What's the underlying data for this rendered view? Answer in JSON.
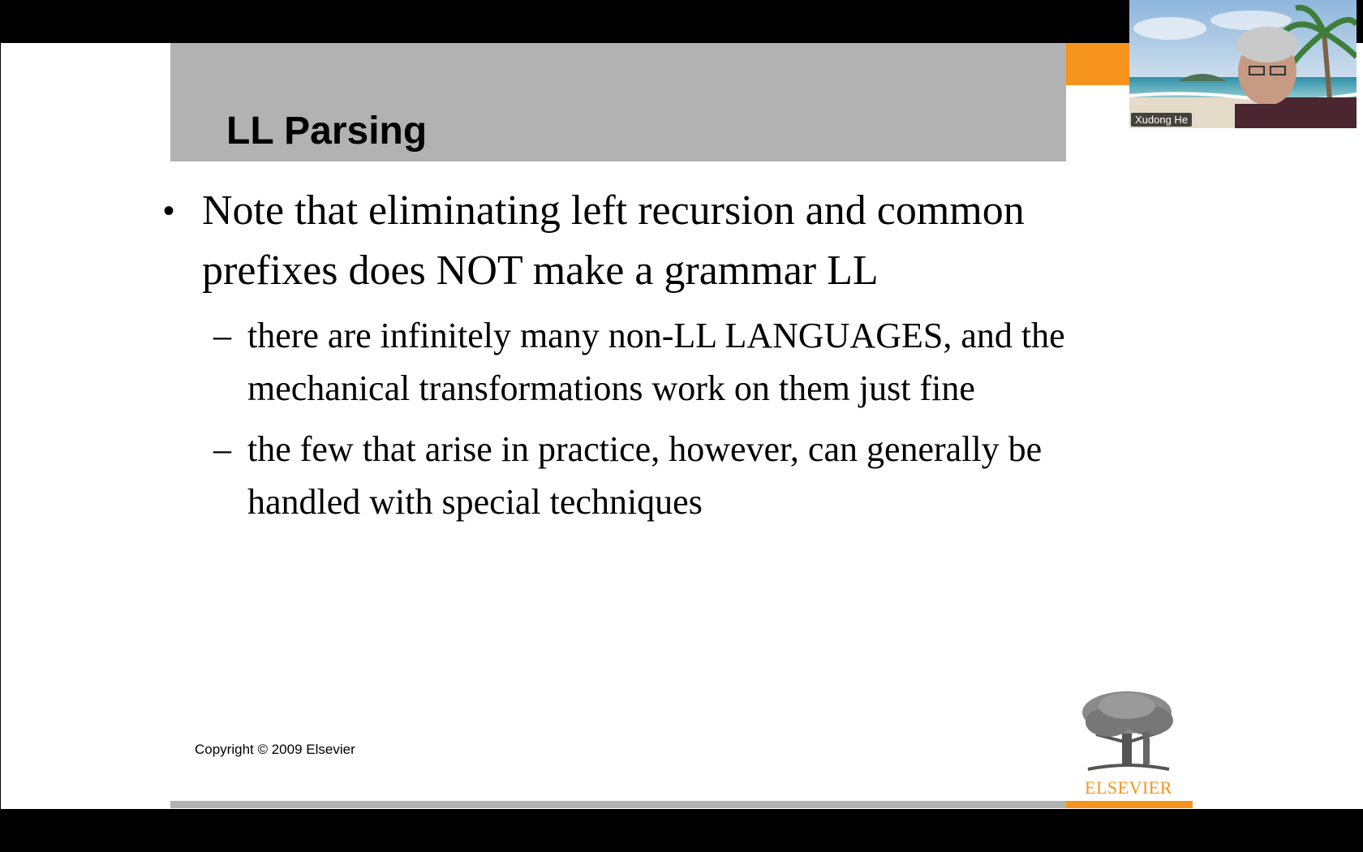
{
  "slide": {
    "title": "LL Parsing",
    "bullets": [
      {
        "text_line1": "Note that eliminating left recursion and common",
        "text_line2": "prefixes does NOT make a grammar LL",
        "subs": [
          {
            "line1": "there are infinitely many non-LL LANGUAGES, and the",
            "line2": "mechanical transformations work on them just fine"
          },
          {
            "line1": "the few that arise in practice, however, can generally be",
            "line2": "handled with special techniques"
          }
        ]
      }
    ],
    "bullet_mark": "•",
    "dash_mark": "–",
    "copyright": "Copyright © 2009 Elsevier",
    "logo_text": "ELSEVIER"
  },
  "video": {
    "participant_name": "Xudong He"
  },
  "colors": {
    "title_band": "#b2b2b2",
    "accent_orange": "#f7941d",
    "background": "#000000"
  }
}
